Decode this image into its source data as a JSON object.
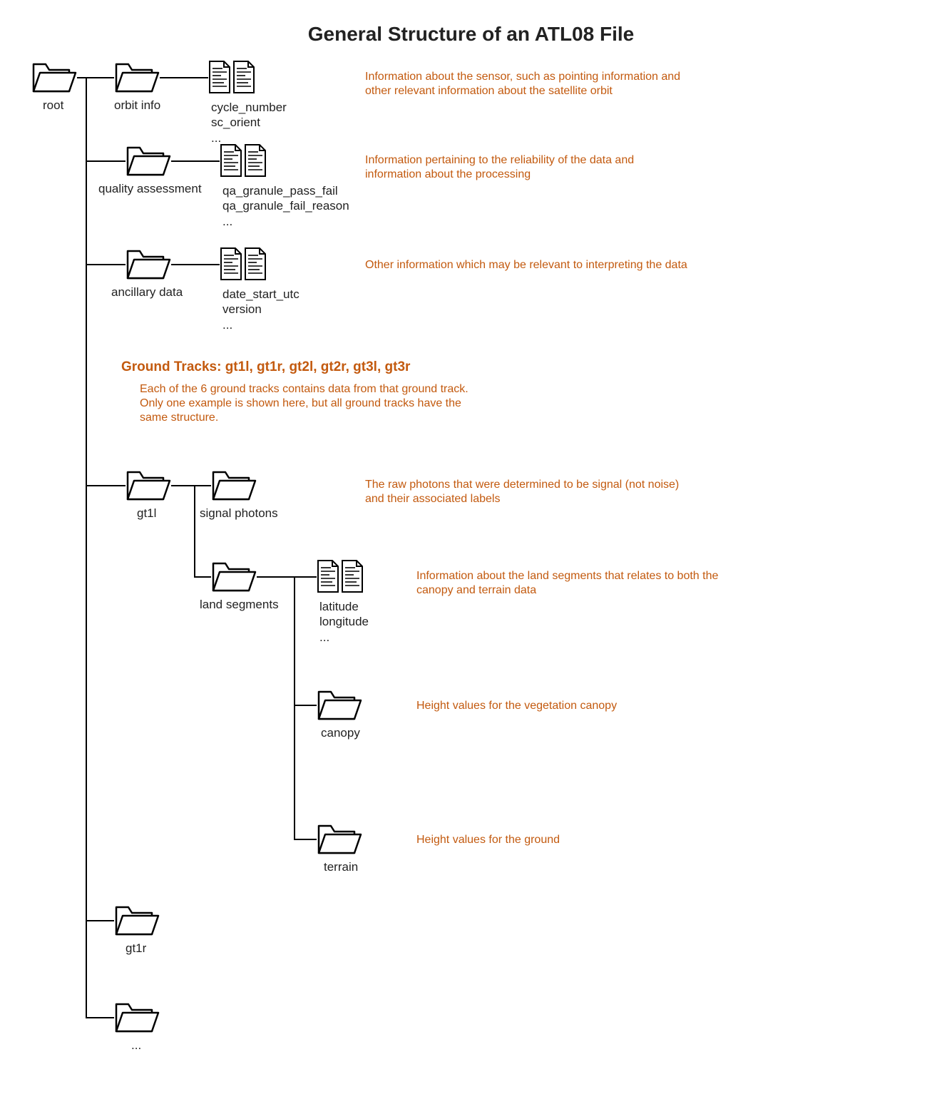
{
  "title": "General Structure of an ATL08 File",
  "labels": {
    "root": "root",
    "orbit_info": "orbit info",
    "orbit_files": "cycle_number\nsc_orient\n...",
    "quality": "quality assessment",
    "quality_files": "qa_granule_pass_fail\nqa_granule_fail_reason\n...",
    "ancillary": "ancillary data",
    "ancillary_files": "date_start_utc\nversion\n...",
    "gt1l": "gt1l",
    "signal_photons": "signal photons",
    "land_segments": "land segments",
    "land_files": "latitude\nlongitude\n...",
    "canopy": "canopy",
    "terrain": "terrain",
    "gt1r": "gt1r",
    "more": "..."
  },
  "gt": {
    "heading": "Ground Tracks: gt1l, gt1r, gt2l, gt2r, gt3l, gt3r",
    "sub": "Each of the 6 ground tracks contains data from that ground track.\nOnly one example is shown here, but all ground tracks have the\nsame structure."
  },
  "desc": {
    "orbit": "Information about the sensor, such as pointing information and\nother relevant information about the satellite orbit",
    "quality": "Information pertaining to the reliability of the data and\ninformation about the processing",
    "ancillary": "Other information which may be relevant to interpreting the data",
    "signal": "The raw photons that were determined to be signal (not noise)\nand their associated labels",
    "land": "Information about the land segments that relates to both the\ncanopy and terrain data",
    "canopy": "Height values for the vegetation canopy",
    "terrain": "Height values for the ground"
  }
}
